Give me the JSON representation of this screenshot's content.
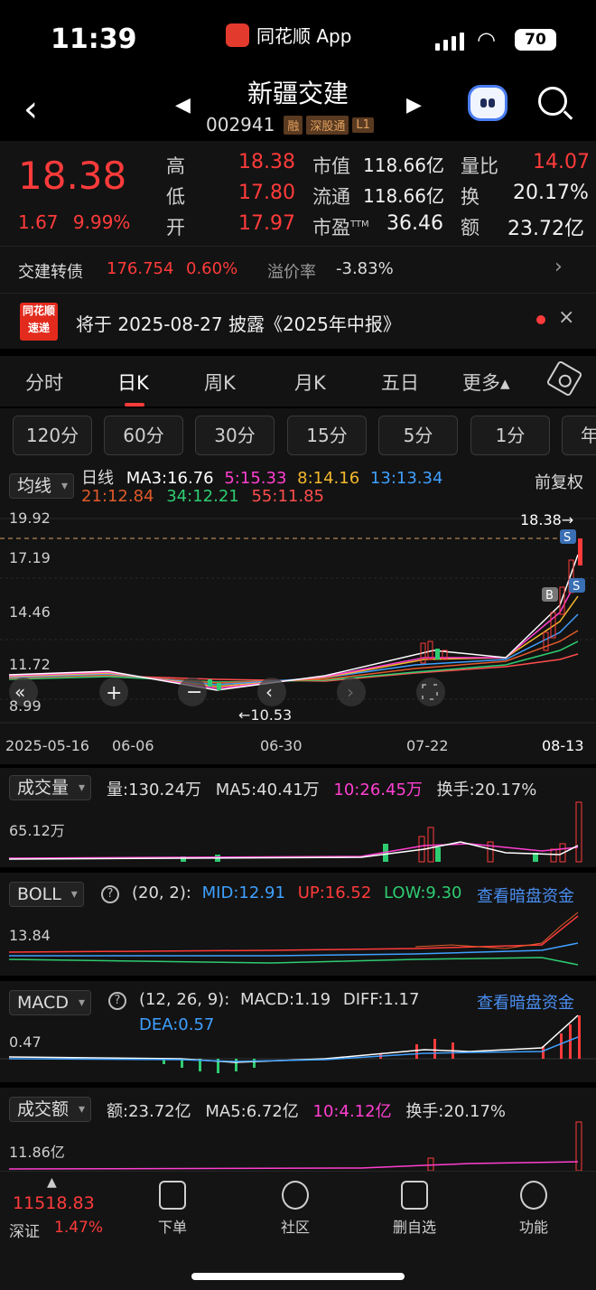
{
  "status_bar": {
    "time": "11:39",
    "app_name": "同花顺 App",
    "battery": "70"
  },
  "header": {
    "stock_name": "新疆交建",
    "stock_code": "002941",
    "tags": [
      "融",
      "深股通",
      "L1"
    ]
  },
  "quote": {
    "price": "18.38",
    "change": "1.67",
    "change_pct": "9.99%",
    "high_label": "高",
    "high": "18.38",
    "low_label": "低",
    "low": "17.80",
    "open_label": "开",
    "open": "17.97",
    "mktcap_label": "市值",
    "mktcap": "118.66亿",
    "float_label": "流通",
    "float": "118.66亿",
    "pe_label": "市盈",
    "pe_sup": "TTM",
    "pe": "36.46",
    "volratio_label": "量比",
    "volratio": "14.07",
    "turnover_label": "换",
    "turnover": "20.17%",
    "amount_label": "额",
    "amount": "23.72亿"
  },
  "bond": {
    "name": "交建转债",
    "price": "176.754",
    "pct": "0.60%",
    "premium_label": "溢价率",
    "premium": "-3.83%"
  },
  "news": {
    "badge_top": "同花顺",
    "badge_bottom": "速递",
    "text": "将于 2025-08-27 披露《2025年中报》"
  },
  "tabs": [
    "分时",
    "日K",
    "周K",
    "月K",
    "五日",
    "更多▴"
  ],
  "intervals": [
    "120分",
    "60分",
    "30分",
    "15分",
    "5分",
    "1分",
    "年"
  ],
  "kline": {
    "ma_selector": "均线",
    "period": "日线",
    "ma3": "MA3:16.76",
    "ma5": "5:15.33",
    "ma8": "8:14.16",
    "ma13": "13:13.34",
    "ma21": "21:12.84",
    "ma34": "34:12.21",
    "ma55": "55:11.85",
    "adjust": "前复权",
    "y_labels": [
      "19.92",
      "17.19",
      "14.46",
      "11.72",
      "8.99"
    ],
    "last_price_tag": "18.38→",
    "low_marker": "←10.53",
    "x_labels": [
      "2025-05-16",
      "06-06",
      "06-30",
      "07-22",
      "08-13"
    ],
    "colors": {
      "ma3": "#ffffff",
      "ma5": "#ff3fd0",
      "ma8": "#f5b82e",
      "ma13": "#3fa0ff",
      "ma21": "#e05a2a",
      "ma34": "#2ecc71",
      "ma55": "#ff4d4d"
    }
  },
  "volume": {
    "selector": "成交量",
    "vol": "量:130.24万",
    "ma5": "MA5:40.41万",
    "ma10": "10:26.45万",
    "turnover": "换手:20.17%",
    "y_label": "65.12万"
  },
  "boll": {
    "selector": "BOLL",
    "params": "(20, 2):",
    "mid": "MID:12.91",
    "up": "UP:16.52",
    "low": "LOW:9.30",
    "link": "查看暗盘资金",
    "y_label": "13.84"
  },
  "macd": {
    "selector": "MACD",
    "params": "(12, 26, 9):",
    "macd": "MACD:1.19",
    "diff": "DIFF:1.17",
    "dea": "DEA:0.57",
    "link": "查看暗盘资金",
    "y_label": "0.47"
  },
  "amount": {
    "selector": "成交额",
    "amt": "额:23.72亿",
    "ma5": "MA5:6.72亿",
    "ma10": "10:4.12亿",
    "turnover": "换手:20.17%",
    "y_label": "11.86亿"
  },
  "bottom_nav": {
    "index_value": "11518.83",
    "index_name": "深证",
    "index_pct": "1.47%",
    "items": [
      "下单",
      "社区",
      "删自选",
      "功能"
    ]
  }
}
